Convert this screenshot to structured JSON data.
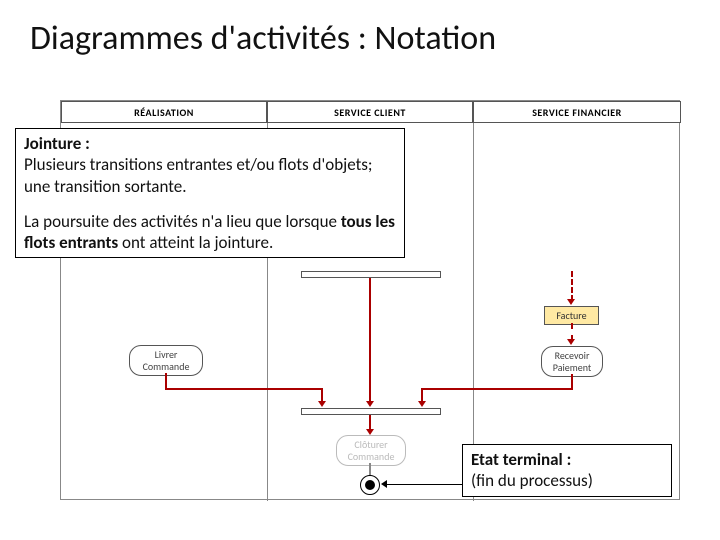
{
  "title": "Diagrammes d'activités : Notation",
  "lanes": {
    "l1": "RÉALISATION",
    "l2": "SERVICE CLIENT",
    "l3": "SERVICE FINANCIER"
  },
  "callout_join": {
    "heading": "Jointure :",
    "line1": "Plusieurs transitions entrantes et/ou flots d'objets; une transition sortante.",
    "line2_a": "La poursuite des activités n'a lieu que lorsque ",
    "line2_bold": "tous les flots entrants",
    "line2_b": " ont atteint la jointure."
  },
  "callout_final": {
    "heading": "Etat terminal :",
    "line1": "(fin du processus)"
  },
  "activities": {
    "livrer": "Livrer\nCommande",
    "facture": "Facture",
    "recevoir": "Recevoir\nPaiement",
    "cloturer": "Clôturer\nCommande"
  }
}
